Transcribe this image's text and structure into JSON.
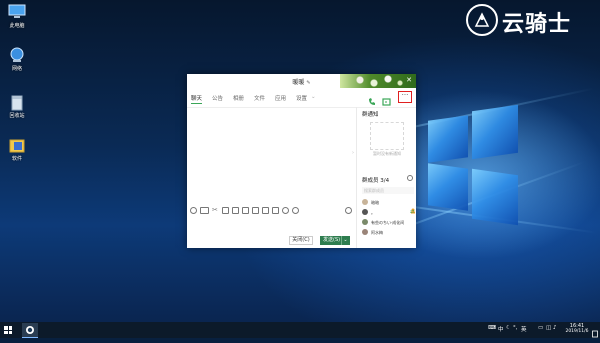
{
  "desktop": {
    "icons": [
      {
        "label": "此电脑",
        "icon": "computer-icon"
      },
      {
        "label": "网络",
        "icon": "network-icon"
      },
      {
        "label": "回收站",
        "icon": "recycle-bin-icon"
      },
      {
        "label": "软件",
        "icon": "folder-icon"
      }
    ],
    "logo_text": "云骑士"
  },
  "window": {
    "title": "暖暖",
    "tabs": [
      {
        "label": "聊天",
        "active": true
      },
      {
        "label": "公告",
        "active": false
      },
      {
        "label": "相册",
        "active": false
      },
      {
        "label": "文件",
        "active": false
      },
      {
        "label": "应用",
        "active": false
      },
      {
        "label": "设置",
        "active": false
      }
    ],
    "more_label": "···",
    "close_button": "关闭(C)",
    "send_button": "发送(S)",
    "right_panel": {
      "notice_title": "群通知",
      "notice_empty": "暂时没有新通知",
      "members_title": "群成员 3/4",
      "search_placeholder": "搜索群成员",
      "members": [
        {
          "name": "暗暗"
        },
        {
          "name": "。"
        },
        {
          "name": "有些のちい·成化间"
        },
        {
          "name": "阿水梅"
        }
      ]
    }
  },
  "taskbar": {
    "tray_lang": "中",
    "tray_input": "英",
    "time": "16:41",
    "date": "2019/11/6"
  },
  "colors": {
    "accent": "#2e7d4f",
    "highlight": "#e02020"
  }
}
